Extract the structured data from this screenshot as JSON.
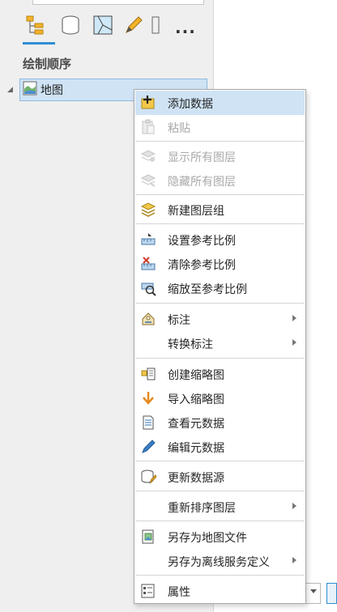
{
  "panel": {
    "section_title": "绘制顺序",
    "tree": {
      "root_label": "地图"
    },
    "tabs": [
      {
        "icon": "drawing-order-icon"
      },
      {
        "icon": "data-source-icon"
      },
      {
        "icon": "selection-icon"
      },
      {
        "icon": "editing-pencil-icon"
      },
      {
        "icon": "snapping-icon"
      }
    ],
    "more_label": "..."
  },
  "menu": {
    "items": [
      {
        "label": "添加数据",
        "icon": "add-data-icon",
        "highlighted": true
      },
      {
        "label": "粘贴",
        "icon": "paste-icon",
        "disabled": true
      },
      {
        "label": "显示所有图层",
        "icon": "show-layers-icon",
        "disabled": true
      },
      {
        "label": "隐藏所有图层",
        "icon": "hide-layers-icon",
        "disabled": true
      },
      {
        "label": "新建图层组",
        "icon": "new-group-layer-icon"
      },
      {
        "label": "设置参考比例",
        "icon": "set-reference-scale-icon"
      },
      {
        "label": "清除参考比例",
        "icon": "clear-reference-scale-icon"
      },
      {
        "label": "缩放至参考比例",
        "icon": "zoom-reference-scale-icon"
      },
      {
        "label": "标注",
        "icon": "label-icon",
        "submenu": true
      },
      {
        "label": "转换标注",
        "icon": "",
        "submenu": true
      },
      {
        "label": "创建缩略图",
        "icon": "create-thumbnail-icon"
      },
      {
        "label": "导入缩略图",
        "icon": "import-thumbnail-icon"
      },
      {
        "label": "查看元数据",
        "icon": "view-metadata-icon"
      },
      {
        "label": "编辑元数据",
        "icon": "edit-metadata-icon"
      },
      {
        "label": "更新数据源",
        "icon": "update-data-source-icon"
      },
      {
        "label": "重新排序图层",
        "icon": "",
        "submenu": true
      },
      {
        "label": "另存为地图文件",
        "icon": "save-map-file-icon"
      },
      {
        "label": "另存为离线服务定义",
        "icon": "",
        "submenu": true
      },
      {
        "label": "属性",
        "icon": "properties-icon"
      }
    ]
  },
  "colors": {
    "highlight": "#cfe3f5",
    "accent": "#2e8fd2",
    "disabled_text": "#a8a8a8"
  }
}
